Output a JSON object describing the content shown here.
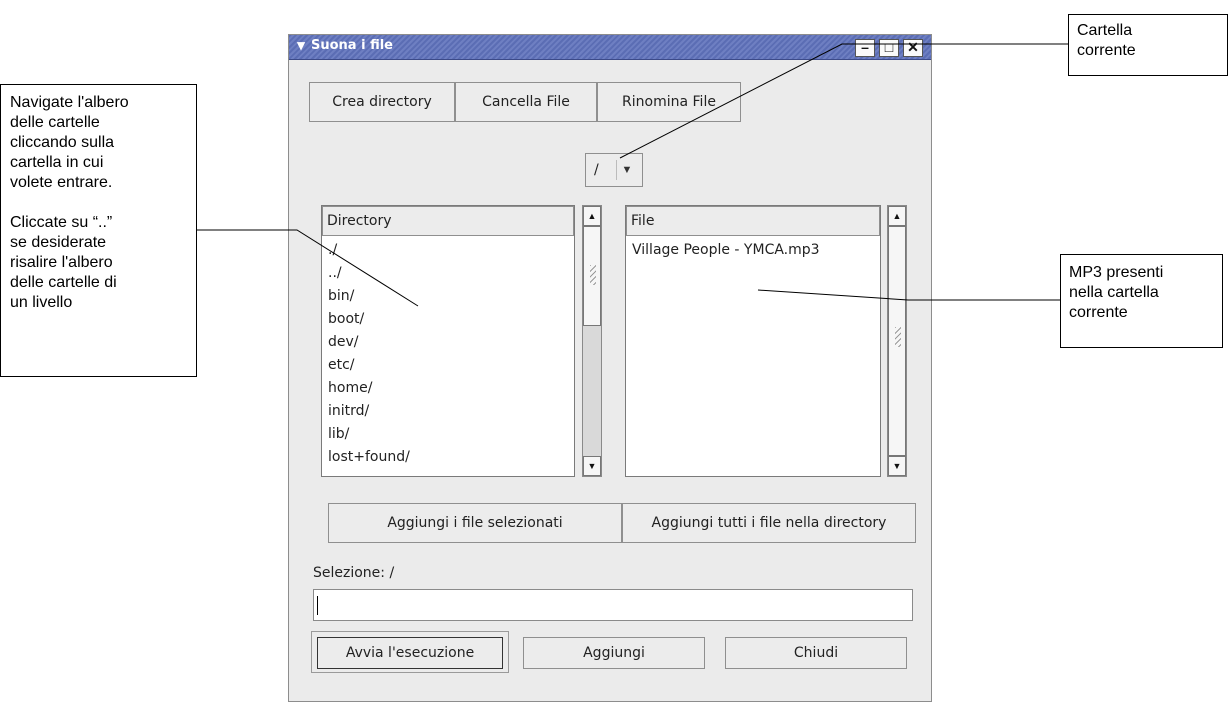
{
  "window": {
    "title": "Suona i file",
    "menu_symbol": "▾",
    "minimize_symbol": "–",
    "maximize_symbol": "□",
    "close_symbol": "✕"
  },
  "toolbar": {
    "create_dir": "Crea directory",
    "delete_file": "Cancella File",
    "rename_file": "Rinomina File"
  },
  "path_combo": {
    "value": "/"
  },
  "directory_list": {
    "header": "Directory",
    "items": [
      "./",
      "../",
      "bin/",
      "boot/",
      "dev/",
      "etc/",
      "home/",
      "initrd/",
      "lib/",
      "lost+found/"
    ]
  },
  "file_list": {
    "header": "File",
    "items": [
      "Village People - YMCA.mp3"
    ]
  },
  "add_buttons": {
    "add_selected": "Aggiungi i file selezionati",
    "add_all": "Aggiungi tutti i file nella directory"
  },
  "selection": {
    "label": "Selezione: /",
    "value": ""
  },
  "bottom_buttons": {
    "play": "Avvia l'esecuzione",
    "add": "Aggiungi",
    "close": "Chiudi"
  },
  "annotations": {
    "current_folder": [
      "Cartella",
      "corrente"
    ],
    "navigate": [
      "Navigate l'albero",
      "delle cartelle",
      "cliccando sulla",
      "cartella in cui",
      "volete entrare."
    ],
    "up_level": [
      "Cliccate su “..”",
      "se desiderate",
      "risalire l'albero",
      "delle cartelle di",
      "un livello"
    ],
    "mp3": [
      "MP3 presenti",
      "nella cartella",
      "corrente"
    ]
  }
}
